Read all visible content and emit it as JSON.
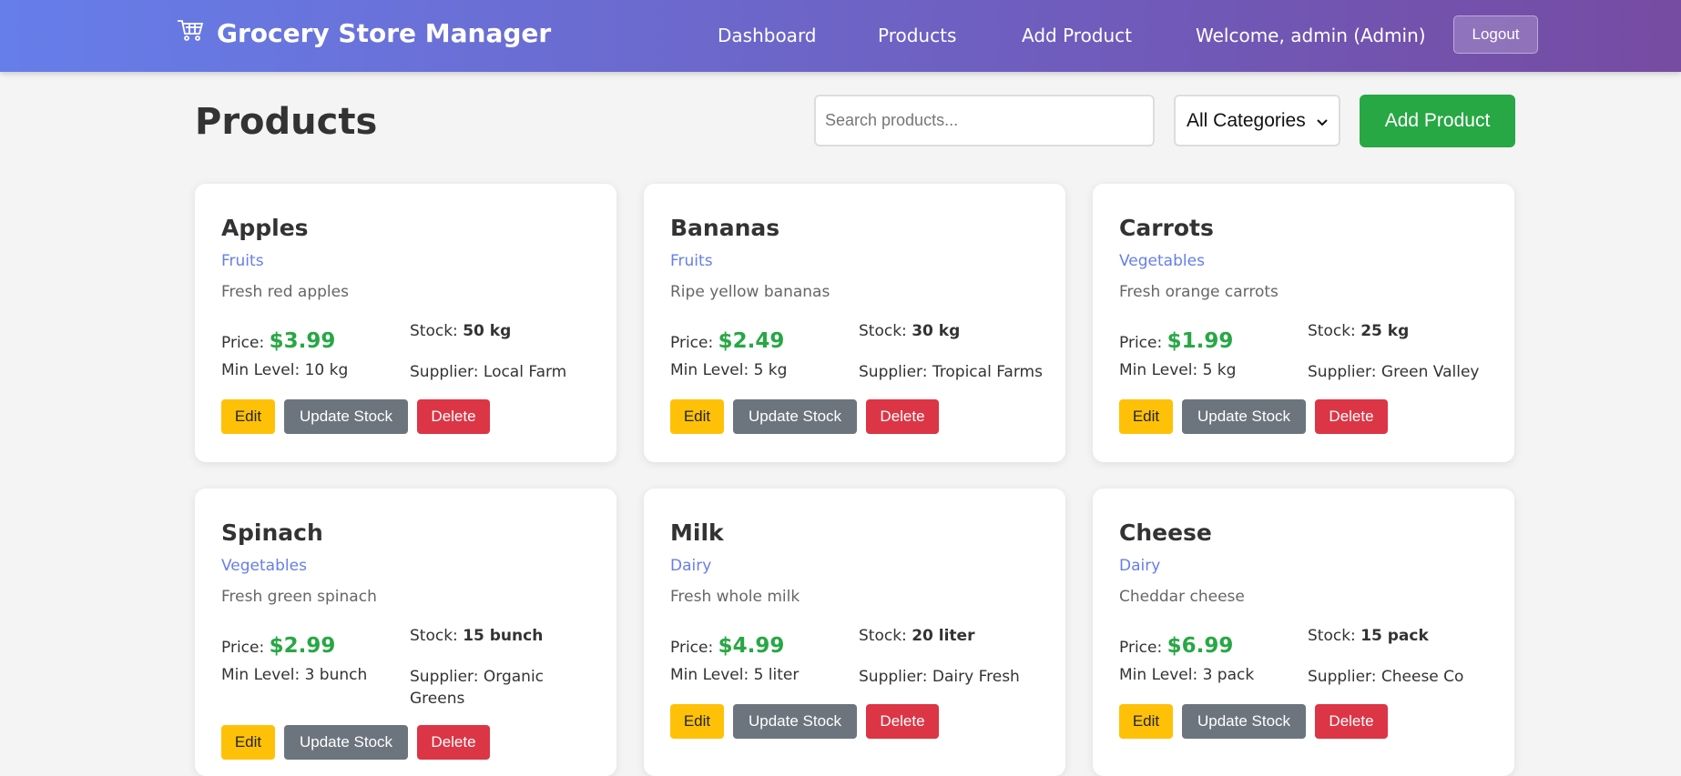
{
  "header": {
    "brand": "Grocery Store Manager",
    "brand_icon": "cart-icon",
    "nav": [
      {
        "label": "Dashboard"
      },
      {
        "label": "Products"
      },
      {
        "label": "Add Product"
      }
    ],
    "welcome": "Welcome, admin (Admin)",
    "logout_label": "Logout"
  },
  "page": {
    "title": "Products",
    "search_placeholder": "Search products...",
    "category_selected": "All Categories",
    "add_button_label": "Add Product"
  },
  "labels": {
    "price": "Price:",
    "stock": "Stock:",
    "min_level": "Min Level:",
    "supplier": "Supplier:",
    "edit": "Edit",
    "update_stock": "Update Stock",
    "delete": "Delete"
  },
  "colors": {
    "accent": "#667eea",
    "header_end": "#764ba2",
    "price_green": "#28a745",
    "edit_yellow": "#ffc107",
    "update_gray": "#6c757d",
    "delete_red": "#dc3545"
  },
  "products": [
    {
      "name": "Apples",
      "category": "Fruits",
      "description": "Fresh red apples",
      "price": "$3.99",
      "stock": "50 kg",
      "min_level": "10 kg",
      "supplier": "Local Farm"
    },
    {
      "name": "Bananas",
      "category": "Fruits",
      "description": "Ripe yellow bananas",
      "price": "$2.49",
      "stock": "30 kg",
      "min_level": "5 kg",
      "supplier": "Tropical Farms"
    },
    {
      "name": "Carrots",
      "category": "Vegetables",
      "description": "Fresh orange carrots",
      "price": "$1.99",
      "stock": "25 kg",
      "min_level": "5 kg",
      "supplier": "Green Valley"
    },
    {
      "name": "Spinach",
      "category": "Vegetables",
      "description": "Fresh green spinach",
      "price": "$2.99",
      "stock": "15 bunch",
      "min_level": "3 bunch",
      "supplier": "Organic Greens"
    },
    {
      "name": "Milk",
      "category": "Dairy",
      "description": "Fresh whole milk",
      "price": "$4.99",
      "stock": "20 liter",
      "min_level": "5 liter",
      "supplier": "Dairy Fresh"
    },
    {
      "name": "Cheese",
      "category": "Dairy",
      "description": "Cheddar cheese",
      "price": "$6.99",
      "stock": "15 pack",
      "min_level": "3 pack",
      "supplier": "Cheese Co"
    }
  ]
}
